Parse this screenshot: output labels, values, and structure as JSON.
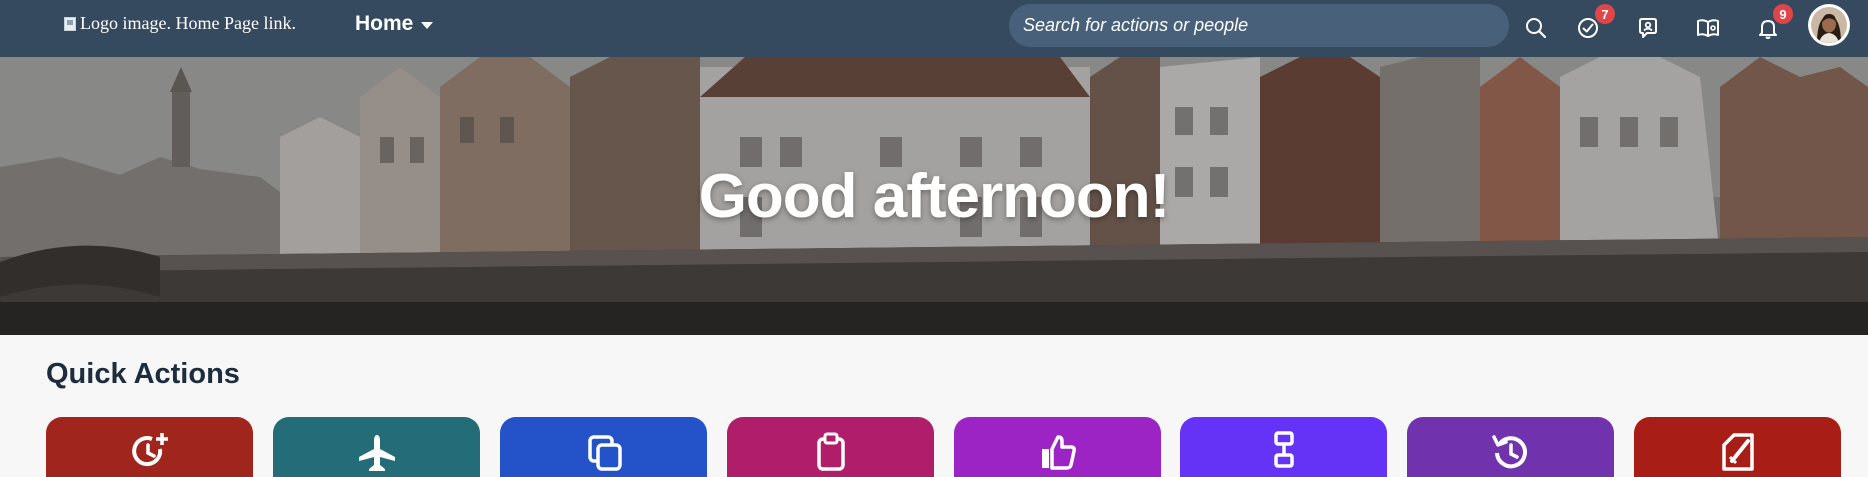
{
  "shellbar": {
    "logo_alt": "Logo image. Home Page link.",
    "home_label": "Home",
    "search_placeholder": "Search for actions or people",
    "badges": {
      "approvals": "7",
      "notifications": "9"
    },
    "icons": [
      "search-icon",
      "approvals-icon",
      "people-help-icon",
      "learning-icon",
      "notifications-icon",
      "avatar"
    ],
    "colors": {
      "bar": "#354a5f",
      "badge": "#e0454a"
    }
  },
  "hero": {
    "greeting": "Good afternoon!"
  },
  "quick_actions": {
    "title": "Quick Actions",
    "tiles": [
      {
        "icon": "time-add-icon",
        "color": "#a0251c"
      },
      {
        "icon": "airplane-icon",
        "color": "#246d78"
      },
      {
        "icon": "copy-icon",
        "color": "#2352c9"
      },
      {
        "icon": "clipboard-icon",
        "color": "#b01e6b"
      },
      {
        "icon": "thumbs-up-icon",
        "color": "#9c24c4"
      },
      {
        "icon": "org-chart-icon",
        "color": "#6433f5"
      },
      {
        "icon": "history-icon",
        "color": "#7133ad"
      },
      {
        "icon": "edit-document-icon",
        "color": "#a81d15"
      }
    ]
  }
}
